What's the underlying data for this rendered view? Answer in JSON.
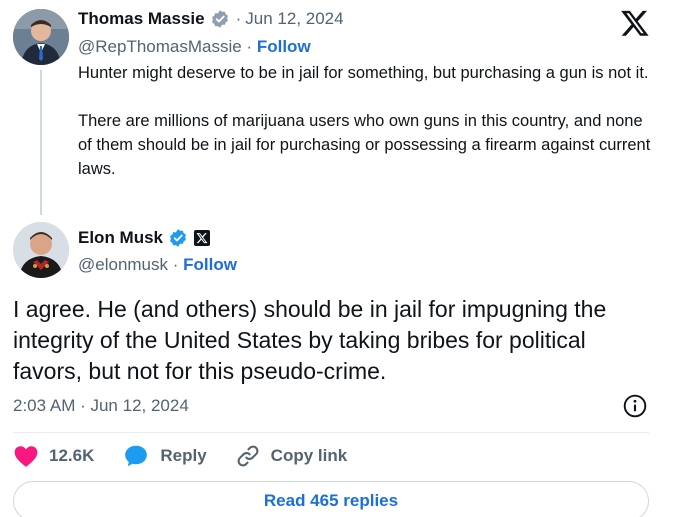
{
  "parent": {
    "name": "Thomas Massie",
    "date": "Jun 12, 2024",
    "date_sep": "·",
    "handle": "@RepThomasMassie",
    "handle_sep": "·",
    "follow_label": "Follow",
    "paragraphs": [
      "Hunter might deserve to be in jail for something, but purchasing a gun is not it.",
      "There are millions of marijuana users who own guns in this country, and none of them should be in jail for purchasing or possessing a firearm against current laws."
    ],
    "badge_color": "#8f9fb0"
  },
  "reply": {
    "name": "Elon Musk",
    "handle": "@elonmusk",
    "handle_sep": "·",
    "follow_label": "Follow",
    "text": "I agree. He (and others) should be in jail for impugning the integrity of the United States by taking bribes for political favors, but not for this pseudo-crime.",
    "timestamp": "2:03 AM · Jun 12, 2024",
    "badge_color": "#1d9bf0"
  },
  "actions": {
    "like_count": "12.6K",
    "reply_label": "Reply",
    "copy_label": "Copy link"
  },
  "read_replies_label": "Read 465 replies",
  "colors": {
    "accent": "#1d6fd8",
    "like": "#f91880",
    "reply": "#1d9bf0",
    "muted": "#536471"
  }
}
